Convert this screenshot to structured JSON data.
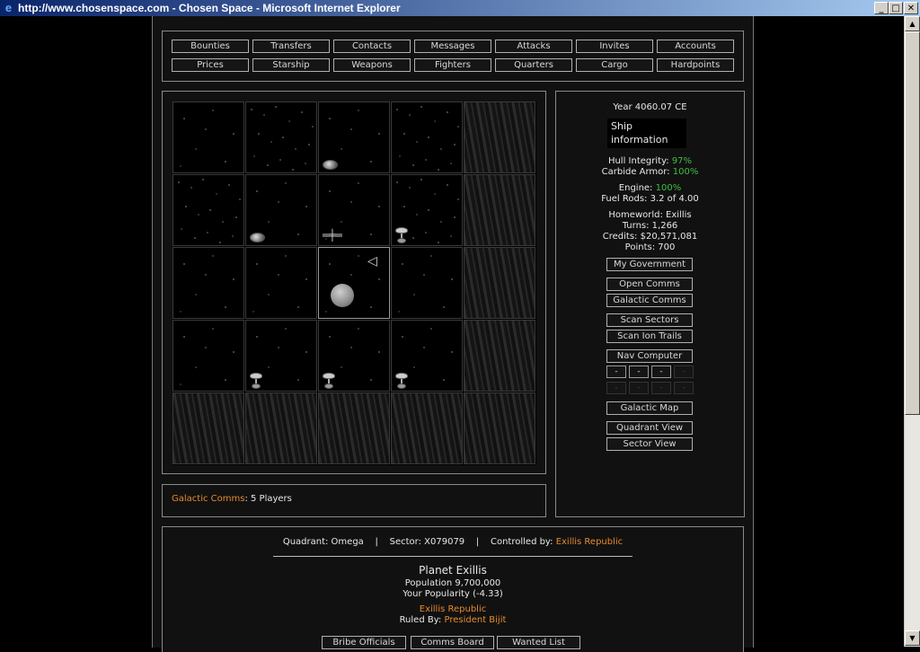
{
  "window": {
    "title": "http://www.chosenspace.com - Chosen Space - Microsoft Internet Explorer",
    "icon": "ie-icon",
    "controls": {
      "minimize": "_",
      "maximize": "□",
      "close": "✕"
    }
  },
  "scrollbar": {
    "up": "▲",
    "down": "▼"
  },
  "nav": {
    "row1": [
      "Bounties",
      "Transfers",
      "Contacts",
      "Messages",
      "Attacks",
      "Invites",
      "Accounts"
    ],
    "row2": [
      "Prices",
      "Starship",
      "Weapons",
      "Fighters",
      "Quarters",
      "Cargo",
      "Hardpoints"
    ]
  },
  "map": {
    "cells": [
      {
        "kind": "stars",
        "objects": []
      },
      {
        "kind": "dense",
        "objects": []
      },
      {
        "kind": "stars",
        "objects": [
          "asteroid"
        ]
      },
      {
        "kind": "dense",
        "objects": []
      },
      {
        "kind": "nebula",
        "objects": []
      },
      {
        "kind": "dense",
        "objects": []
      },
      {
        "kind": "stars",
        "objects": [
          "asteroid"
        ]
      },
      {
        "kind": "stars",
        "objects": [
          "ship"
        ]
      },
      {
        "kind": "dense",
        "objects": [
          "station"
        ]
      },
      {
        "kind": "nebula",
        "objects": []
      },
      {
        "kind": "stars",
        "objects": []
      },
      {
        "kind": "stars",
        "objects": []
      },
      {
        "kind": "current",
        "objects": [
          "planet",
          "cursor"
        ]
      },
      {
        "kind": "stars",
        "objects": []
      },
      {
        "kind": "nebula",
        "objects": []
      },
      {
        "kind": "stars",
        "objects": []
      },
      {
        "kind": "stars",
        "objects": [
          "station"
        ]
      },
      {
        "kind": "stars",
        "objects": [
          "station"
        ]
      },
      {
        "kind": "stars",
        "objects": [
          "station"
        ]
      },
      {
        "kind": "nebula",
        "objects": []
      },
      {
        "kind": "nebula",
        "objects": []
      },
      {
        "kind": "nebula",
        "objects": []
      },
      {
        "kind": "nebula",
        "objects": []
      },
      {
        "kind": "nebula",
        "objects": []
      },
      {
        "kind": "nebula",
        "objects": []
      }
    ]
  },
  "comms_status": {
    "label": "Galactic Comms",
    "value": ": 5 Players"
  },
  "info": {
    "year": "Year 4060.07 CE",
    "ship_info": "Ship information",
    "hull_label": "Hull Integrity: ",
    "hull_value": "97%",
    "armor_label": "Carbide Armor: ",
    "armor_value": "100%",
    "engine_label": "Engine: ",
    "engine_value": "100%",
    "fuel": "Fuel Rods: 3.2 of 4.00",
    "homeworld": "Homeworld: Exillis",
    "turns": "Turns: 1,266",
    "credits": "Credits: $20,571,081",
    "points": "Points: 700",
    "buttons": {
      "government": "My Government",
      "open_comms": "Open Comms",
      "galactic_comms": "Galactic Comms",
      "scan_sectors": "Scan Sectors",
      "scan_ion": "Scan Ion Trails",
      "nav_computer": "Nav Computer",
      "galactic_map": "Galactic Map",
      "quadrant_view": "Quadrant View",
      "sector_view": "Sector View"
    },
    "nav_slots": [
      "-",
      "-",
      "-",
      "-",
      "-",
      "-",
      "-",
      "-"
    ]
  },
  "sector": {
    "quadrant": "Quadrant: Omega",
    "sep": "|",
    "sector": "Sector: X079079",
    "controlled_label": "Controlled by: ",
    "controlled_value": "Exillis Republic",
    "planet": "Planet Exillis",
    "population": "Population 9,700,000",
    "popularity": "Your Popularity (-4.33)",
    "faction": "Exillis Republic",
    "ruled_label": "Ruled By: ",
    "ruled_value": "President Bijit",
    "bottom_buttons": [
      "Bribe Officials",
      "Comms Board",
      "Wanted List"
    ]
  },
  "colors": {
    "accent": "#e68a2e",
    "good": "#3fbf3f",
    "background": "#111111"
  }
}
